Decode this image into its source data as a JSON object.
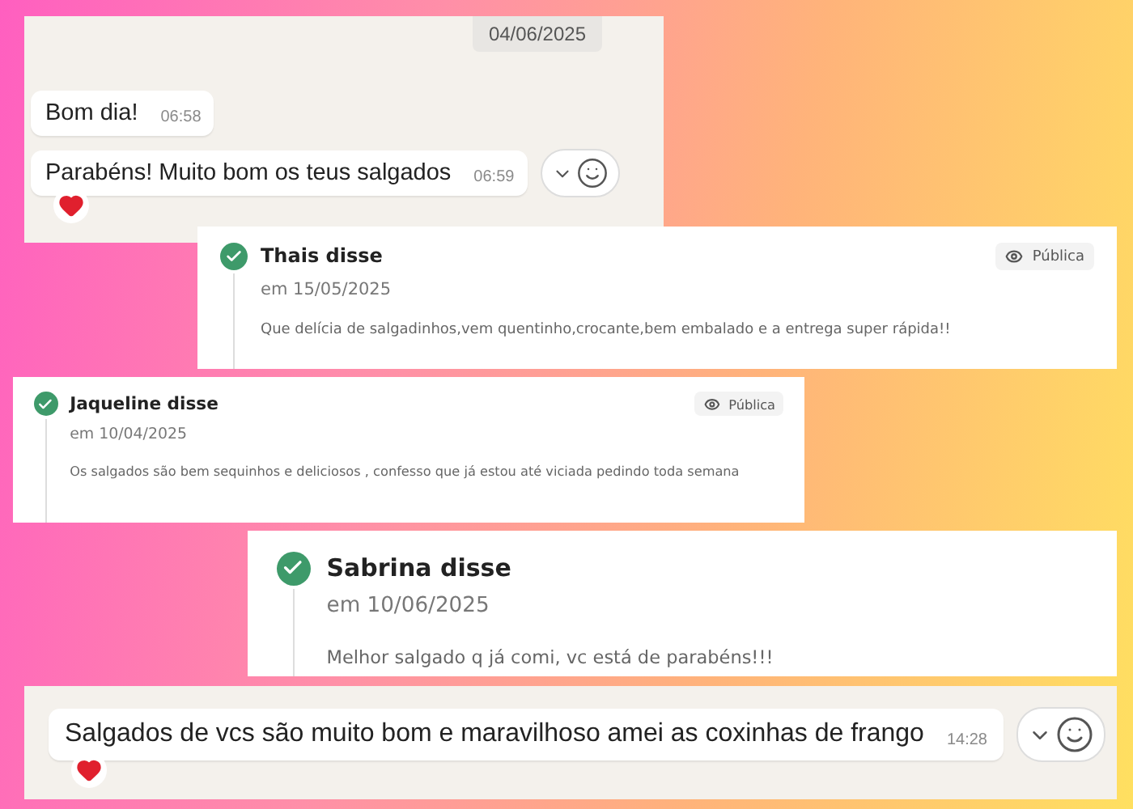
{
  "clips": [
    {
      "kind": "chat",
      "date": "04/06/2025",
      "messages": [
        {
          "text": "Bom dia!",
          "time": "06:58",
          "reacted": false,
          "hovered": false
        },
        {
          "text": "Parabéns! Muito bom os teus salgados",
          "time": "06:59",
          "reacted": true,
          "hovered": true
        }
      ]
    },
    {
      "kind": "review",
      "author": "Thais disse",
      "date": "em 15/05/2025",
      "text": "Que delícia de salgadinhos,vem quentinho,crocante,bem embalado e a entrega super rápida!!",
      "visibility": "Pública"
    },
    {
      "kind": "review",
      "author": "Jaqueline disse",
      "date": "em 10/04/2025",
      "text": "Os salgados são bem sequinhos e deliciosos , confesso que já estou até viciada pedindo toda semana",
      "visibility": "Pública"
    },
    {
      "kind": "review",
      "author": "Sabrina disse",
      "date": "em 10/06/2025",
      "text": "Melhor salgado q já comi, vc está de parabéns!!!"
    },
    {
      "kind": "chat",
      "messages": [
        {
          "text": "Salgados de vcs são muito bom e maravilhoso amei as coxinhas de frango",
          "time": "14:28",
          "reacted": true,
          "hovered": true
        }
      ]
    }
  ]
}
